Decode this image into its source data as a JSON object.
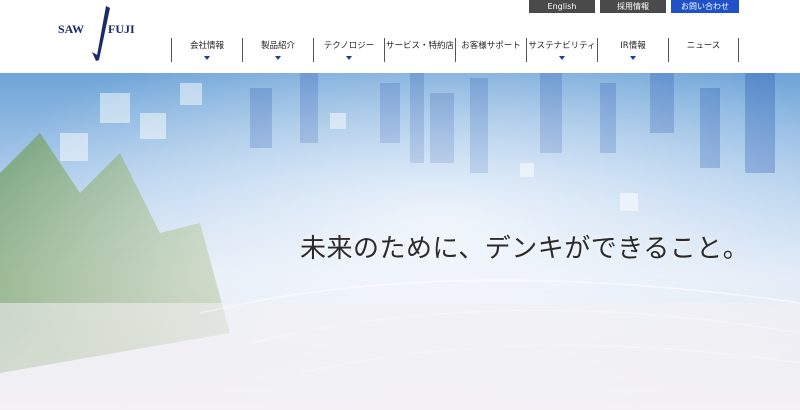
{
  "logo": {
    "left": "SAW",
    "right": "FUJI",
    "icon": "sawafuji-logo-icon"
  },
  "top_links": [
    {
      "label": "English"
    },
    {
      "label": "採用情報"
    },
    {
      "label": "お問い合わせ"
    }
  ],
  "nav": [
    {
      "label": "会社情報",
      "has_menu": true
    },
    {
      "label": "製品紹介",
      "has_menu": true
    },
    {
      "label": "テクノロジー",
      "has_menu": true
    },
    {
      "label": "サービス・特約店",
      "has_menu": false
    },
    {
      "label": "お客様サポート",
      "has_menu": false
    },
    {
      "label": "サステナビリティ",
      "has_menu": true
    },
    {
      "label": "IR情報",
      "has_menu": true
    },
    {
      "label": "ニュース",
      "has_menu": false
    }
  ],
  "hero": {
    "tagline": "未来のために、デンキができること。"
  },
  "colors": {
    "brand_navy": "#1b2a6b",
    "contact_blue": "#1f52c8",
    "top_link_gray": "#4a4a4a",
    "caret_blue": "#1d3f8f"
  }
}
